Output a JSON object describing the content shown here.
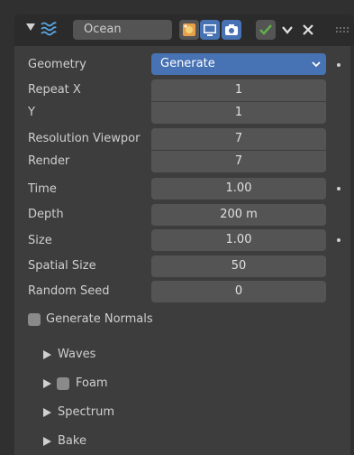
{
  "modifier": {
    "name": "Ocean",
    "colors": {
      "header": "#2b2b2b",
      "panel": "#3d3d3d",
      "field": "#545454",
      "accent": "#4772b3",
      "active_check": "#5fb04a"
    },
    "icons": [
      "collapse-triangle-icon",
      "ocean-waves-icon",
      "editmode-icon",
      "realtime-display-icon",
      "render-camera-icon",
      "apply-check-icon",
      "dropdown-chevron-icon",
      "close-x-icon",
      "drag-handle-icon"
    ]
  },
  "fields": {
    "geometry": {
      "label": "Geometry",
      "value": "Generate"
    },
    "repeat_x": {
      "label": "Repeat X",
      "value": "1"
    },
    "repeat_y": {
      "label": "Y",
      "value": "1"
    },
    "resolution_viewport": {
      "label": "Resolution Viewpor",
      "value": "7"
    },
    "resolution_render": {
      "label": "Render",
      "value": "7"
    },
    "time": {
      "label": "Time",
      "value": "1.00"
    },
    "depth": {
      "label": "Depth",
      "value": "200 m"
    },
    "size": {
      "label": "Size",
      "value": "1.00"
    },
    "spatial_size": {
      "label": "Spatial Size",
      "value": "50"
    },
    "random_seed": {
      "label": "Random Seed",
      "value": "0"
    }
  },
  "generate_normals": {
    "label": "Generate Normals",
    "checked": false
  },
  "subpanels": [
    {
      "label": "Waves",
      "checkbox": false
    },
    {
      "label": "Foam",
      "checkbox": true
    },
    {
      "label": "Spectrum",
      "checkbox": false
    },
    {
      "label": "Bake",
      "checkbox": false
    }
  ]
}
